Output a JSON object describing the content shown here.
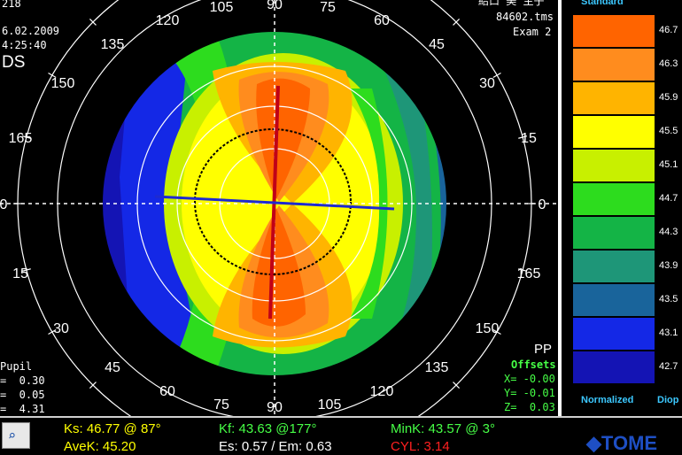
{
  "header": {
    "left_line1": "218",
    "left_line2": "6.02.2009",
    "left_line3": "4:25:40",
    "eye": "DS",
    "right_line1": "給口 美 主子",
    "right_line2": "84602.tms",
    "right_line3": "Exam 2"
  },
  "angles": [
    "105",
    "90",
    "75",
    "120",
    "60",
    "135",
    "45",
    "150",
    "30",
    "165",
    "15",
    "0",
    "0",
    "15",
    "165",
    "30",
    "150",
    "45",
    "135",
    "60",
    "120",
    "75",
    "90",
    "105"
  ],
  "pupil": {
    "title": "Pupil",
    "line1": "=  0.30",
    "line2": "=  0.05",
    "line3": "=  4.31"
  },
  "offsets": {
    "pp": "PP",
    "title": "Offsets",
    "x": "X= -0.00",
    "y": "Y= -0.01",
    "z": "Z=  0.03"
  },
  "legend": {
    "title": "Standard",
    "footer_left": "Normalized",
    "footer_right": "Diop",
    "scale": [
      {
        "value": "46.7",
        "color": "#ff6400"
      },
      {
        "value": "46.3",
        "color": "#ff8c1e"
      },
      {
        "value": "45.9",
        "color": "#ffb400"
      },
      {
        "value": "45.5",
        "color": "#ffff00"
      },
      {
        "value": "45.1",
        "color": "#c8f000"
      },
      {
        "value": "44.7",
        "color": "#2ddc1e"
      },
      {
        "value": "44.3",
        "color": "#14b446"
      },
      {
        "value": "43.9",
        "color": "#1e9678"
      },
      {
        "value": "43.5",
        "color": "#19649b"
      },
      {
        "value": "43.1",
        "color": "#1428e6"
      },
      {
        "value": "42.7",
        "color": "#1414b4"
      }
    ]
  },
  "readouts": {
    "ks": "Ks: 46.77 @ 87°",
    "avek": "AveK: 45.20",
    "kf": "Kf: 43.63 @177°",
    "es_em": "Es: 0.57 / Em: 0.63",
    "mink": "MinK: 43.57 @  3°",
    "cyl": "CYL: 3.14",
    "brand": "TOME"
  },
  "colors": {
    "ks": "#ffff00",
    "avek": "#ffff00",
    "kf": "#46ff46",
    "mink": "#46ff46",
    "cyl": "#ff2020",
    "es_em": "#ffffff",
    "accent_label": "#3cc8ff",
    "offsets_value": "#46ff46"
  }
}
